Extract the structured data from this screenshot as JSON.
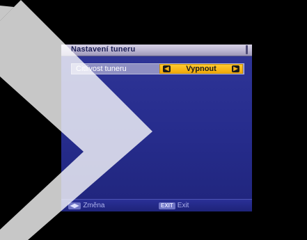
{
  "menu": {
    "title": "Nastavení tuneru",
    "items": [
      {
        "label": "Citlivost tuneru",
        "value": "Vypnout"
      }
    ]
  },
  "footer": {
    "change_key": "◀▶",
    "change_label": "Změna",
    "exit_key": "EXIT",
    "exit_label": "Exit"
  },
  "colors": {
    "panel": "#2a2f92",
    "title_bar": "#c8c3dc",
    "selected_row": "#8e8fc3",
    "value_box": "#f5b313"
  },
  "icons": [
    "left-arrow-icon",
    "right-arrow-icon",
    "play-overlay-icon"
  ]
}
